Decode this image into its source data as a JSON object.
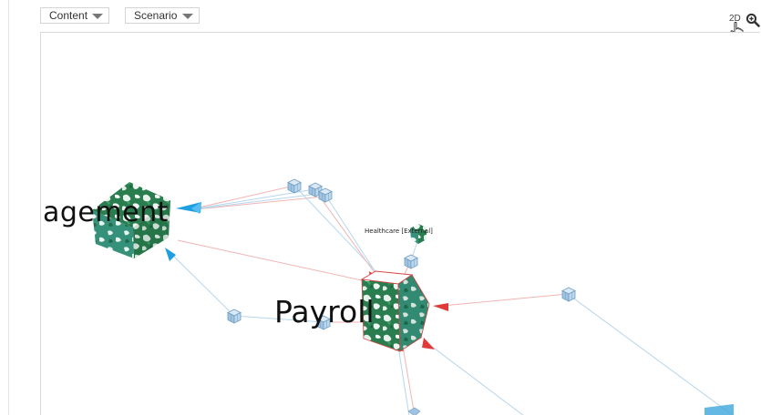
{
  "toolbar": {
    "content_label": "Content",
    "scenario_label": "Scenario",
    "mode_toggle": "2D",
    "zoom_icon": "magnifier-zoom-icon",
    "cursor_icon": "hand-pointer-icon"
  },
  "graph": {
    "nodes": {
      "management": "agement",
      "payroll": "Payroll",
      "healthcare": "Healthcare [External]"
    }
  },
  "colors": {
    "link_red": "#f0a0a0",
    "link_blue": "#a8cfe6",
    "arrow_red": "#e03a3a",
    "arrow_blue": "#1e9fe0",
    "cube_green": "#2e8b57",
    "small_cube": "#7fb3d8"
  }
}
